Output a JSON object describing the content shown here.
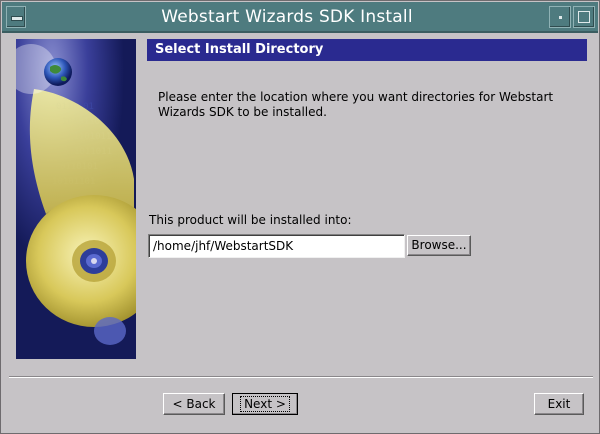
{
  "window": {
    "title": "Webstart Wizards SDK Install"
  },
  "header": {
    "title": "Select Install Directory"
  },
  "body": {
    "instruction": "Please enter the location where you want directories for Webstart Wizards SDK  to be installed.",
    "install_label": "This product will be installed into:",
    "path_value": "/home/jhf/WebstartSDK",
    "browse_label": "Browse..."
  },
  "footer": {
    "back_label": "< Back",
    "next_label": "Next >",
    "exit_label": "Exit"
  },
  "colors": {
    "header_bar": "#2a2a90",
    "titlebar": "#4e7b7f",
    "window_bg": "#c6c3c6"
  },
  "icons": {
    "window_menu": "window-menu-icon",
    "minimize": "minimize-icon",
    "maximize": "maximize-icon"
  }
}
